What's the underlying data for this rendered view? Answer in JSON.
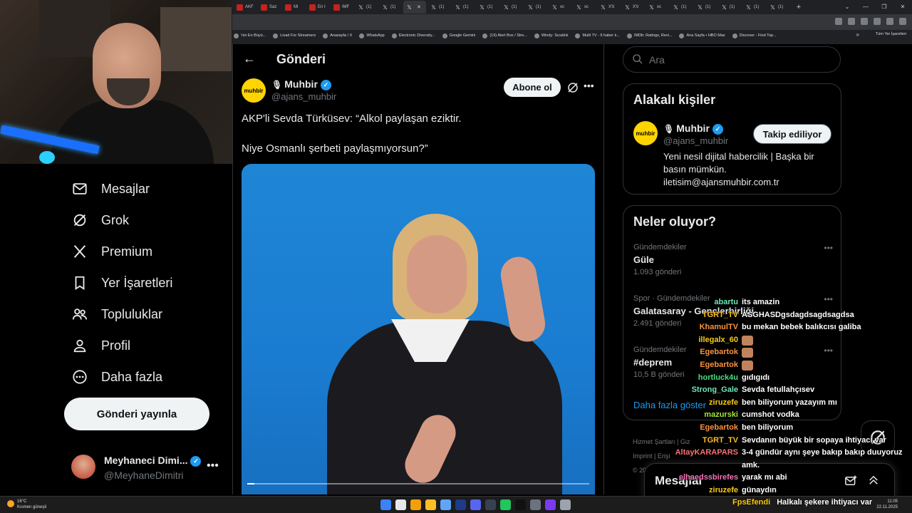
{
  "browser": {
    "tabs": [
      {
        "label": "AKF",
        "icon": "red"
      },
      {
        "label": "Saz",
        "icon": "red"
      },
      {
        "label": "Mi",
        "icon": "red"
      },
      {
        "label": "En I",
        "icon": "red"
      },
      {
        "label": "IMF",
        "icon": "red"
      },
      {
        "label": "(1)",
        "icon": "x"
      },
      {
        "label": "(1)",
        "icon": "x"
      },
      {
        "label": "",
        "icon": "x",
        "active": true
      },
      {
        "label": "(1)",
        "icon": "x"
      },
      {
        "label": "(1)",
        "icon": "x"
      },
      {
        "label": "(1)",
        "icon": "x"
      },
      {
        "label": "(1)",
        "icon": "x"
      },
      {
        "label": "(1)",
        "icon": "x"
      },
      {
        "label": "xc",
        "icon": "x"
      },
      {
        "label": "xc",
        "icon": "x"
      },
      {
        "label": "X'ti",
        "icon": "x"
      },
      {
        "label": "X'ti",
        "icon": "x"
      },
      {
        "label": "xc",
        "icon": "x"
      },
      {
        "label": "(1)",
        "icon": "x"
      },
      {
        "label": "(1)",
        "icon": "x"
      },
      {
        "label": "(1)",
        "icon": "x"
      },
      {
        "label": "(1)",
        "icon": "x"
      },
      {
        "label": "(1)",
        "icon": "x"
      }
    ],
    "bookmarks": [
      "'nin En Büyü...",
      "Livad For Streamers",
      "Anasayfa / X",
      "WhatsApp",
      "Electronic Diversity...",
      "Google Gemini",
      "(19) Alert Box / Stre...",
      "Windy: Sıcaklık",
      "Multi TV - 6 haber k...",
      "IMDb: Ratings, Revi...",
      "Ana Sayfa • HBO Max",
      "Discover - Find Top..."
    ],
    "bookmarks_more": "»",
    "bookmarks_right": "Tüm Yer İşaretleri"
  },
  "nav": {
    "items": [
      {
        "label": "Mesajlar",
        "icon": "mail-icon"
      },
      {
        "label": "Grok",
        "icon": "grok-icon"
      },
      {
        "label": "Premium",
        "icon": "x-logo-icon"
      },
      {
        "label": "Yer İşaretleri",
        "icon": "bookmark-icon"
      },
      {
        "label": "Topluluklar",
        "icon": "people-icon"
      },
      {
        "label": "Profil",
        "icon": "person-icon"
      },
      {
        "label": "Daha fazla",
        "icon": "more-circle-icon"
      }
    ],
    "post_button": "Gönderi yayınla",
    "account": {
      "name": "Meyhaneci Dimi...",
      "handle": "@MeyhaneDimitri",
      "more": "•••"
    }
  },
  "main": {
    "back": "←",
    "title": "Gönderi",
    "post": {
      "author_name": "Muhbir",
      "author_handle": "@ajans_muhbir",
      "avatar_text": "muhbir",
      "follow_label": "Abone ol",
      "more": "•••",
      "text_line1": "AKP'li Sevda Türküsev: “Alkol paylaşan eziktir.",
      "text_line2": "Niye Osmanlı şerbeti paylaşmıyorsun?”",
      "video_progress": 0.02
    }
  },
  "right": {
    "search_placeholder": "Ara",
    "related": {
      "title": "Alakalı kişiler",
      "name": "Muhbir",
      "handle": "@ajans_muhbir",
      "avatar_text": "muhbir",
      "button": "Takip ediliyor",
      "bio": "Yeni nesil dijital habercilik | Başka bir basın mümkün. iletisim@ajansmuhbir.com.tr"
    },
    "trends": {
      "title": "Neler oluyor?",
      "items": [
        {
          "category": "Gündemdekiler",
          "name": "Güle",
          "count": "1.093 gönderi"
        },
        {
          "category": "Spor · Gündemdekiler",
          "name": "Galatasaray - Gençlerbirliği",
          "count": "2.491 gönderi"
        },
        {
          "category": "Gündemdekiler",
          "name": "#deprem",
          "count": "10,5 B gönderi"
        }
      ],
      "show_more": "Daha fazla göster",
      "more": "•••"
    },
    "footer": [
      "Hizmet Şartları  |  Giz",
      "Imprint  |  Erişi",
      "© 20"
    ]
  },
  "messages_drawer": {
    "title": "Mesajlar"
  },
  "chat": [
    {
      "user": "abartu",
      "color": "#6ee7b7",
      "msg": "its amazin"
    },
    {
      "user": "TGRT_TV",
      "color": "#fbbf24",
      "msg": "ASGHASDgsdagdsagdsagdsa"
    },
    {
      "user": "KhamulTV",
      "color": "#fb923c",
      "msg": "bu mekan bebek balıkcısı galiba"
    },
    {
      "user": "illegalx_60",
      "color": "#facc15",
      "msg": "",
      "emote": true
    },
    {
      "user": "Egebartok",
      "color": "#fb923c",
      "msg": "",
      "emote": true
    },
    {
      "user": "Egebartok",
      "color": "#fb923c",
      "msg": "",
      "emote": true
    },
    {
      "user": "hortluck4u",
      "color": "#4ade80",
      "msg": "gıdıgıdı"
    },
    {
      "user": "Strong_Gale",
      "color": "#6ee7b7",
      "msg": "Sevda fetullahçısev"
    },
    {
      "user": "ziruzefe",
      "color": "#facc15",
      "msg": "ben biliyorum yazayım mı"
    },
    {
      "user": "mazurski",
      "color": "#a3e635",
      "msg": "cumshot vodka"
    },
    {
      "user": "Egebartok",
      "color": "#fb923c",
      "msg": "ben biliyorum"
    },
    {
      "user": "TGRT_TV",
      "color": "#fbbf24",
      "msg": "Sevdanın büyük bir sopaya ihtiyacı var"
    },
    {
      "user": "AltayKARAPARS",
      "color": "#f87171",
      "msg": "3-4 gündür aynı şeye bakıp bakıp duuyoruz"
    },
    {
      "user": "",
      "color": "#ffffff",
      "msg": "amk."
    },
    {
      "user": "elhaedssbirefes",
      "color": "#f472b6",
      "msg": "yarak mı abi"
    },
    {
      "user": "ziruzefe",
      "color": "#facc15",
      "msg": "günaydın"
    }
  ],
  "chat_bottom": {
    "user": "FpsEfendi",
    "color": "#facc15",
    "msg": "Halkalı şekere ihtiyacı var"
  },
  "taskbar": {
    "weather_temp": "16°C",
    "weather_desc": "Kısmen güneşli",
    "time": "11:05",
    "date": "22.11.2025"
  }
}
